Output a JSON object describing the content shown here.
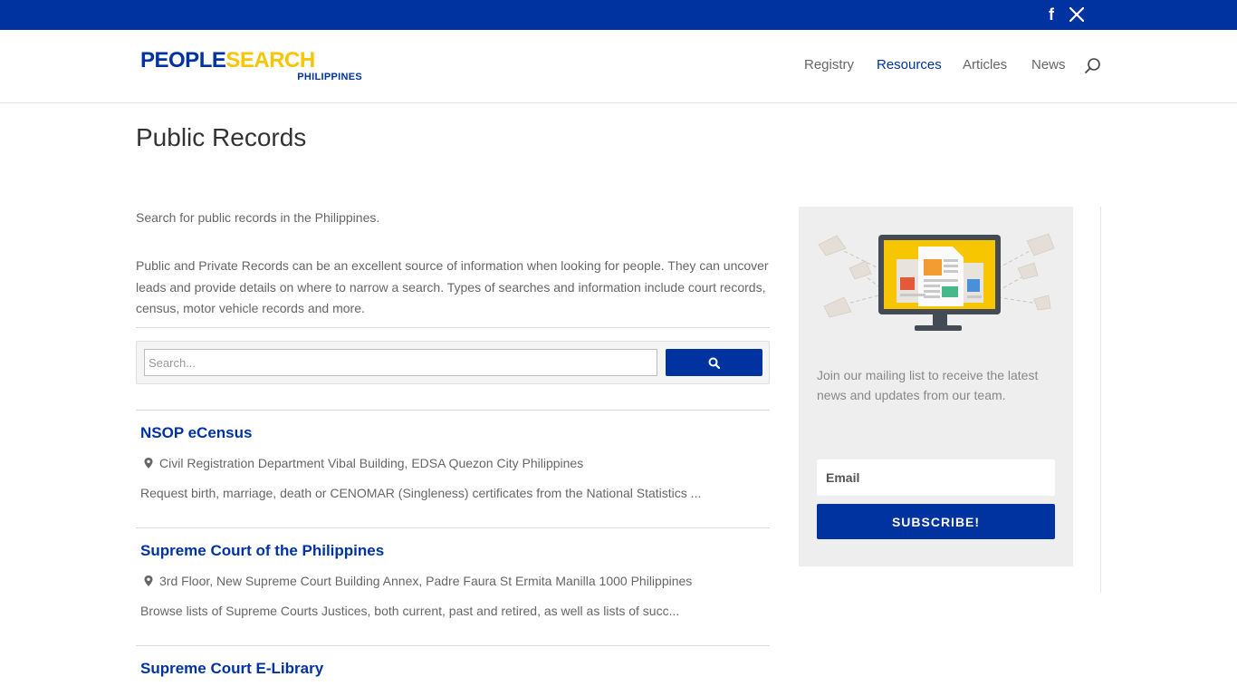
{
  "topbar": {
    "social": [
      {
        "icon": "facebook-icon",
        "glyph": "f"
      },
      {
        "icon": "x-icon"
      }
    ]
  },
  "header": {
    "logo": {
      "part1": "PEOPLE",
      "part2": "SEARCH",
      "sub": "PHILIPPINES"
    },
    "nav": [
      {
        "label": "Registry",
        "active": false
      },
      {
        "label": "Resources",
        "active": true
      },
      {
        "label": "Articles",
        "active": false
      },
      {
        "label": "News",
        "active": false
      }
    ]
  },
  "page": {
    "title": "Public Records",
    "intro": "Search for public records in the Philippines.",
    "body": "Public and Private Records can be an excellent source of information when looking for people. They can uncover leads and provide details on where to narrow a search. Types of searches and information include court records, census, motor vehicle records and more."
  },
  "search": {
    "placeholder": "Search..."
  },
  "listings": [
    {
      "title": "NSOP eCensus",
      "address": "Civil Registration Department Vibal Building, EDSA Quezon City Philippines",
      "description": "Request birth, marriage, death or CENOMAR (Singleness) certificates from the National Statistics ..."
    },
    {
      "title": "Supreme Court of the Philippines",
      "address": "3rd Floor, New Supreme Court Building Annex, Padre Faura St Ermita Manilla 1000 Philippines",
      "description": "Browse lists of Supreme Courts Justices, both current, past and retired, as well as lists of succ..."
    },
    {
      "title": "Supreme Court E-Library"
    }
  ],
  "sidebar": {
    "mail_text": "Join our mailing list to receive the latest news and updates from our team.",
    "email_placeholder": "Email",
    "subscribe_label": "SUBSCRIBE!"
  },
  "colors": {
    "brand_blue": "#0033a0",
    "brand_yellow": "#f7c600"
  }
}
